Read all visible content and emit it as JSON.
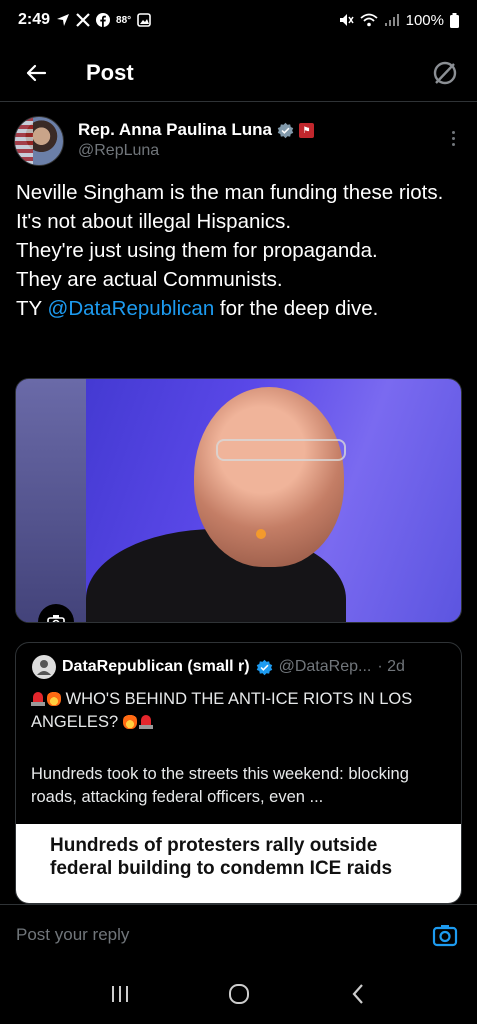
{
  "status_bar": {
    "time": "2:49",
    "temp": "88°",
    "battery": "100%",
    "icons": [
      "navigation-icon",
      "x-app-icon",
      "facebook-icon",
      "gallery-icon",
      "mute-icon",
      "wifi-icon",
      "signal-icon",
      "battery-icon"
    ]
  },
  "header": {
    "title": "Post",
    "back_icon": "arrow-left-icon",
    "grok_icon": "grok-icon"
  },
  "post": {
    "author_name": "Rep. Anna Paulina Luna",
    "author_handle": "@RepLuna",
    "text_before_mention": "Neville Singham is the man funding these riots.\nIt's not about illegal Hispanics.\nThey're just using them for propaganda.\nThey are actual Communists.\nTY ",
    "mention": "@DataRepublican",
    "text_after_mention": " for the deep dive.",
    "image_alt_icon": "camera-icon"
  },
  "quote": {
    "name": "DataRepublican (small r)",
    "handle": "@DataRep...",
    "time": "· 2d",
    "title": "WHO'S BEHIND THE ANTI-ICE RIOTS IN LOS ANGELES?",
    "body": "Hundreds took to the streets this weekend: blocking roads, attacking federal officers, even ...",
    "card_headline": "Hundreds of protesters rally outside federal building to condemn ICE raids"
  },
  "reply": {
    "placeholder": "Post your reply"
  },
  "colors": {
    "accent": "#1d9bf0",
    "background": "#000000",
    "muted": "#71767b"
  }
}
